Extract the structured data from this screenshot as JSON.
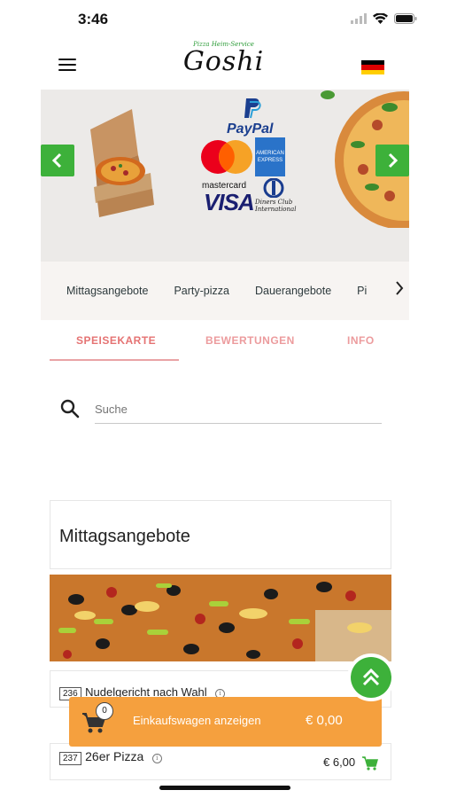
{
  "status_bar": {
    "time": "3:46"
  },
  "header": {
    "logo_tagline": "Pizza Heim-Service",
    "logo_name": "Goshi",
    "language_flag": "german-flag-icon",
    "flag_colors": [
      "#000000",
      "#dd0000",
      "#ffce00"
    ]
  },
  "banner": {
    "payment_text": {
      "paypal": "PayPal",
      "mastercard": "mastercard",
      "amex_line1": "AMERICAN",
      "amex_line2": "EXPRESS",
      "visa": "VISA",
      "diners_line1": "Diners Club",
      "diners_line2": "International"
    }
  },
  "categories": [
    "Mittagsangebote",
    "Party-pizza",
    "Dauerangebote",
    "Pi"
  ],
  "tabs": [
    {
      "label": "SPEISEKARTE",
      "active": true
    },
    {
      "label": "BEWERTUNGEN",
      "active": false
    },
    {
      "label": "INFO",
      "active": false
    }
  ],
  "search": {
    "placeholder": "Suche"
  },
  "section": {
    "title": "Mittagsangebote"
  },
  "items": [
    {
      "number": "236",
      "name": "Nudelgericht nach Wahl"
    },
    {
      "number": "237",
      "name": "26er Pizza",
      "price": "€ 6,00"
    }
  ],
  "cart": {
    "count": "0",
    "label": "Einkaufswagen anzeigen",
    "total": "€ 0,00"
  },
  "colors": {
    "accent_green": "#3db13a",
    "cart_orange": "#f5a03e",
    "tab_active": "#e57373",
    "tab_inactive": "#ec9b9d"
  }
}
